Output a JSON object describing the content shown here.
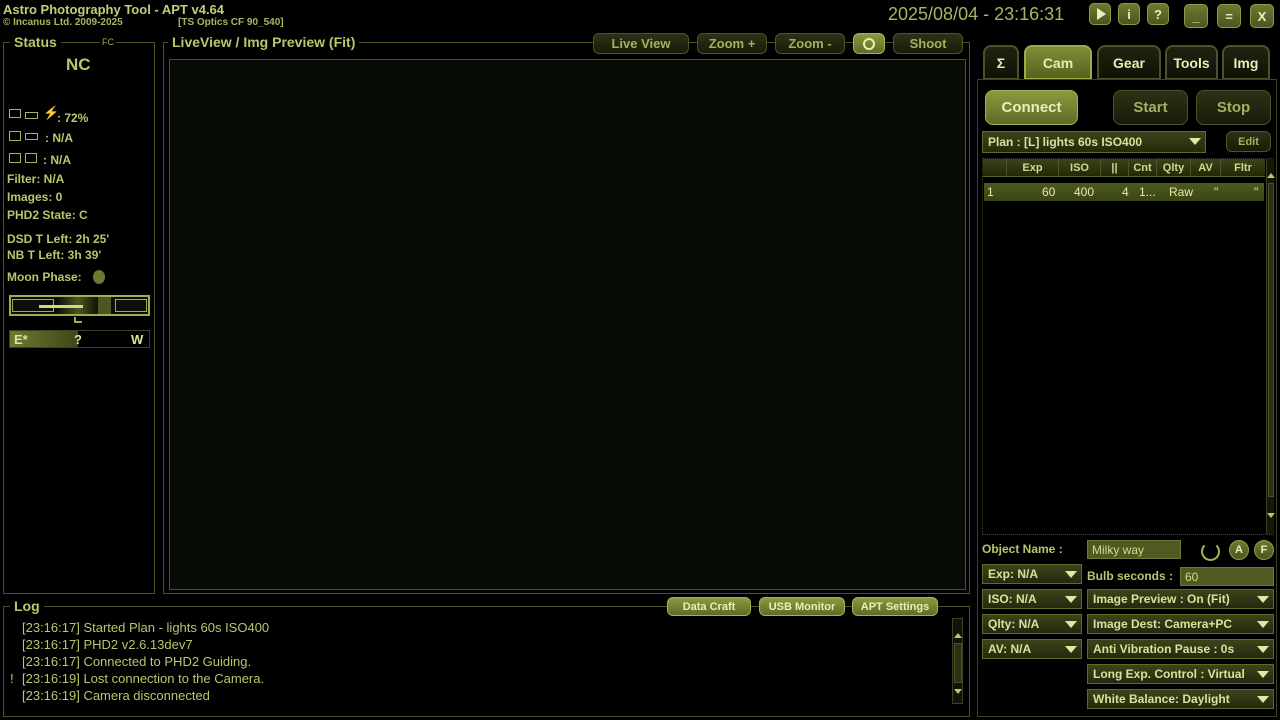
{
  "app": {
    "title": "Astro Photography Tool  -  APT v4.64",
    "copyright": "© Incanus Ltd. 2009-2025",
    "profile": "[TS Optics CF 90_540]",
    "datetime": "2025/08/04 - 23:16:31"
  },
  "window_controls": {
    "minimize": "_",
    "maximize": "=",
    "close": "X"
  },
  "help_buttons": {
    "play": "",
    "info": "i",
    "help": "?"
  },
  "status": {
    "title": "Status",
    "fc": "FC",
    "connection": "NC",
    "battery": ": 72%",
    "camera_line": ": N/A",
    "cooler_line": ": N/A",
    "filter": "Filter: N/A",
    "images": "Images: 0",
    "phd2_state": "PHD2 State: C",
    "dsd_left": "DSD T Left: 2h 25'",
    "nb_left": "NB T Left: 3h 39'",
    "moon_phase": "Moon Phase:",
    "east": "E*",
    "unknown": "?",
    "west": "W"
  },
  "preview": {
    "title": "LiveView / Img Preview (Fit)",
    "buttons": {
      "live_view": "Live View",
      "zoom_in": "Zoom +",
      "zoom_out": "Zoom -",
      "shoot": "Shoot"
    }
  },
  "tabs": {
    "sigma": "Σ",
    "cam": "Cam",
    "gear": "Gear",
    "tools": "Tools",
    "img": "Img"
  },
  "cam": {
    "connect": "Connect",
    "start": "Start",
    "stop": "Stop",
    "plan": "Plan : [L] lights 60s ISO400",
    "edit": "Edit",
    "table": {
      "headers": [
        "",
        "Exp",
        "ISO",
        "||",
        "Cnt",
        "Qlty",
        "AV",
        "Fltr"
      ],
      "rows": [
        [
          "1",
          "60",
          "400",
          "4",
          "1...",
          "Raw",
          "\"",
          "\""
        ]
      ]
    },
    "object_name_label": "Object Name :",
    "object_name_value": "Milky way",
    "a_btn": "A",
    "f_btn": "F",
    "bulb_label": "Bulb seconds :",
    "bulb_value": "60",
    "left_dropdowns": [
      "Exp: N/A",
      "ISO: N/A",
      "Qlty: N/A",
      "AV: N/A"
    ],
    "right_dropdowns": [
      "Image Preview : On (Fit)",
      "Image Dest: Camera+PC",
      "Anti Vibration Pause : 0s",
      "Long Exp. Control : Virtual",
      "White Balance: Daylight"
    ]
  },
  "log": {
    "title": "Log",
    "buttons": {
      "data_craft": "Data Craft",
      "usb_monitor": "USB Monitor",
      "apt_settings": "APT Settings"
    },
    "lines": [
      {
        "mark": "",
        "text": "[23:16:17] Started Plan - lights 60s ISO400"
      },
      {
        "mark": "",
        "text": "[23:16:17] PHD2 v2.6.13dev7"
      },
      {
        "mark": "",
        "text": "[23:16:17] Connected to PHD2 Guiding."
      },
      {
        "mark": "!",
        "text": "[23:16:19] Lost connection to the Camera."
      },
      {
        "mark": "",
        "text": "[23:16:19] Camera disconnected"
      }
    ]
  },
  "colors": {
    "accent": "#a4b452",
    "text": "#b8c66c",
    "background": "#000000"
  }
}
